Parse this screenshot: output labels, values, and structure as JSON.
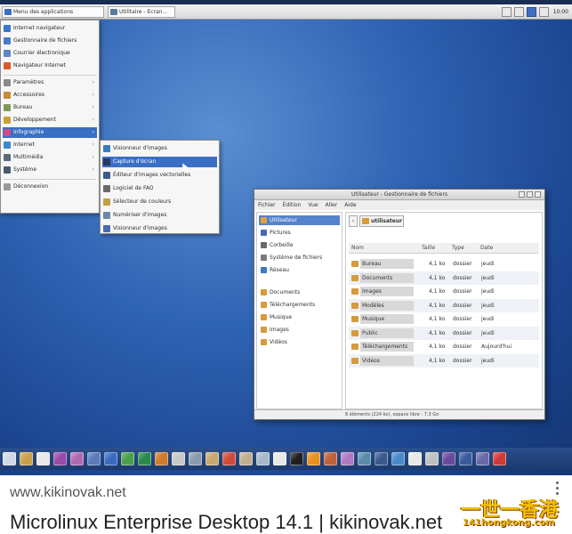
{
  "top_panel": {
    "app_menu_label": "Menu des applications",
    "task_label": "Utilitaire - Ecran..."
  },
  "clock": "10:00",
  "main_menu": {
    "items": [
      {
        "label": "Internet navigateur",
        "icon": "globe-icon",
        "color": "#3b78c9",
        "has_sub": false
      },
      {
        "label": "Gestionnaire de fichiers",
        "icon": "folder-icon",
        "color": "#4a7bc8",
        "has_sub": false
      },
      {
        "label": "Courrier électronique",
        "icon": "mail-icon",
        "color": "#5a88c2",
        "has_sub": false
      },
      {
        "label": "Navigateur Internet",
        "icon": "browser-icon",
        "color": "#d85a2a",
        "has_sub": false
      },
      {
        "label": "Paramètres",
        "icon": "settings-icon",
        "color": "#8a8a8a",
        "has_sub": true
      },
      {
        "label": "Accessoires",
        "icon": "accessories-icon",
        "color": "#c88a3a",
        "has_sub": true
      },
      {
        "label": "Bureau",
        "icon": "office-icon",
        "color": "#7a9a5a",
        "has_sub": true
      },
      {
        "label": "Développement",
        "icon": "development-icon",
        "color": "#caa030",
        "has_sub": true
      },
      {
        "label": "Infographie",
        "icon": "graphics-icon",
        "color": "#d04a8a",
        "has_sub": true
      },
      {
        "label": "Internet",
        "icon": "internet-icon",
        "color": "#3a8ad0",
        "has_sub": true
      },
      {
        "label": "Multimédia",
        "icon": "multimedia-icon",
        "color": "#5a6a7a",
        "has_sub": true
      },
      {
        "label": "Système",
        "icon": "system-icon",
        "color": "#4a5a6a",
        "has_sub": true
      },
      {
        "label": "Déconnexion",
        "icon": "logout-icon",
        "color": "#9a9a9a",
        "has_sub": false
      }
    ],
    "selected_index": 8
  },
  "sub_menu": {
    "items": [
      {
        "label": "Visionneur d'images",
        "icon": "image-viewer-icon",
        "color": "#3a7ac0"
      },
      {
        "label": "Capture d'écran",
        "icon": "screenshot-icon",
        "color": "#2a3a5a"
      },
      {
        "label": "Éditeur d'images vectorielles",
        "icon": "vector-icon",
        "color": "#3a5a8a"
      },
      {
        "label": "Logiciel de FAO",
        "icon": "fao-icon",
        "color": "#6a6a6a"
      },
      {
        "label": "Sélecteur de couleurs",
        "icon": "color-picker-icon",
        "color": "#c0a040"
      },
      {
        "label": "Numériser d'images",
        "icon": "scanner-icon",
        "color": "#6a8aaa"
      },
      {
        "label": "Visionneur d'images",
        "icon": "picture-icon",
        "color": "#4a6ab0"
      }
    ],
    "selected_index": 1
  },
  "file_manager": {
    "title": "Utilisateur - Gestionnaire de fichiers",
    "menubar": [
      "Fichier",
      "Édition",
      "Vue",
      "Aller",
      "Aide"
    ],
    "sidebar": [
      {
        "label": "Utilisateur",
        "color": "#e0a040",
        "selected": true
      },
      {
        "label": "Pictures",
        "color": "#4a6ab0",
        "selected": false
      },
      {
        "label": "Corbeille",
        "color": "#6a6a6a",
        "selected": false
      },
      {
        "label": "Système de fichiers",
        "color": "#7a7a7a",
        "selected": false
      },
      {
        "label": "Réseau",
        "color": "#3a7ac0",
        "selected": false
      },
      {
        "label": "Documents",
        "color": "#d89a3a",
        "selected": false
      },
      {
        "label": "Téléchargements",
        "color": "#d89a3a",
        "selected": false
      },
      {
        "label": "Musique",
        "color": "#d89a3a",
        "selected": false
      },
      {
        "label": "Images",
        "color": "#d89a3a",
        "selected": false
      },
      {
        "label": "Vidéos",
        "color": "#d89a3a",
        "selected": false
      }
    ],
    "path_label": "utilisateur",
    "columns": [
      "Nom",
      "Taille",
      "Type",
      "Date"
    ],
    "rows": [
      {
        "name": "Bureau",
        "size": "4,1 ko",
        "type": "dossier",
        "date": "jeudi"
      },
      {
        "name": "Documents",
        "size": "4,1 ko",
        "type": "dossier",
        "date": "jeudi"
      },
      {
        "name": "Images",
        "size": "4,1 ko",
        "type": "dossier",
        "date": "jeudi"
      },
      {
        "name": "Modèles",
        "size": "4,1 ko",
        "type": "dossier",
        "date": "jeudi"
      },
      {
        "name": "Musique",
        "size": "4,1 ko",
        "type": "dossier",
        "date": "jeudi"
      },
      {
        "name": "Public",
        "size": "4,1 ko",
        "type": "dossier",
        "date": "jeudi"
      },
      {
        "name": "Téléchargements",
        "size": "4,1 ko",
        "type": "dossier",
        "date": "Aujourd'hui"
      },
      {
        "name": "Vidéos",
        "size": "4,1 ko",
        "type": "dossier",
        "date": "jeudi"
      }
    ],
    "status": "8 éléments (224 ko), espace libre : 7,3 Go"
  },
  "dock": {
    "icons": [
      {
        "icon": "show-desktop-icon",
        "color": "#d0d8e8"
      },
      {
        "icon": "terminal-icon",
        "color": "#caa14a"
      },
      {
        "icon": "file-manager-icon",
        "color": "#e8e8e8"
      },
      {
        "icon": "calendar-icon",
        "color": "#9a4aa8"
      },
      {
        "icon": "settings-tool-icon",
        "color": "#b06ab0"
      },
      {
        "icon": "network-icon",
        "color": "#5a7ab8"
      },
      {
        "icon": "web-icon",
        "color": "#3a6ac0"
      },
      {
        "icon": "office-doc-icon",
        "color": "#4aa04a"
      },
      {
        "icon": "spreadsheet-icon",
        "color": "#2a8a4a"
      },
      {
        "icon": "presentation-icon",
        "color": "#d07a2a"
      },
      {
        "icon": "edit-icon",
        "color": "#c8c8c8"
      },
      {
        "icon": "graphics-tool-icon",
        "color": "#8a9ab0"
      },
      {
        "icon": "archive-icon",
        "color": "#c8a870"
      },
      {
        "icon": "calendar-app-icon",
        "color": "#d04a3a"
      },
      {
        "icon": "mail-client-icon",
        "color": "#c0b090"
      },
      {
        "icon": "image-app-icon",
        "color": "#a8b8c8"
      },
      {
        "icon": "notes-icon",
        "color": "#e8e8e8"
      },
      {
        "icon": "cd-icon",
        "color": "#202020"
      },
      {
        "icon": "music-icon",
        "color": "#e89020"
      },
      {
        "icon": "photo-icon",
        "color": "#c0603a"
      },
      {
        "icon": "video-icon",
        "color": "#b07ac0"
      },
      {
        "icon": "game-icon",
        "color": "#5a8aa8"
      },
      {
        "icon": "media-icon",
        "color": "#3a5a8a"
      },
      {
        "icon": "download-icon",
        "color": "#4a8ac8"
      },
      {
        "icon": "clock-icon",
        "color": "#e8e8e8"
      },
      {
        "icon": "system-monitor-icon",
        "color": "#c0c0c0"
      },
      {
        "icon": "user-icon",
        "color": "#6a4a9a"
      },
      {
        "icon": "security-icon",
        "color": "#3a5aa0"
      },
      {
        "icon": "display-icon",
        "color": "#6a6aa8"
      },
      {
        "icon": "help-icon",
        "color": "#d03a3a"
      }
    ]
  },
  "caption": {
    "source": "www.kikinovak.net",
    "title": "Microlinux Enterprise Desktop 14.1 | kikinovak.net"
  },
  "watermark": {
    "main": "一世一香港",
    "sub": "141hongkong.com"
  }
}
